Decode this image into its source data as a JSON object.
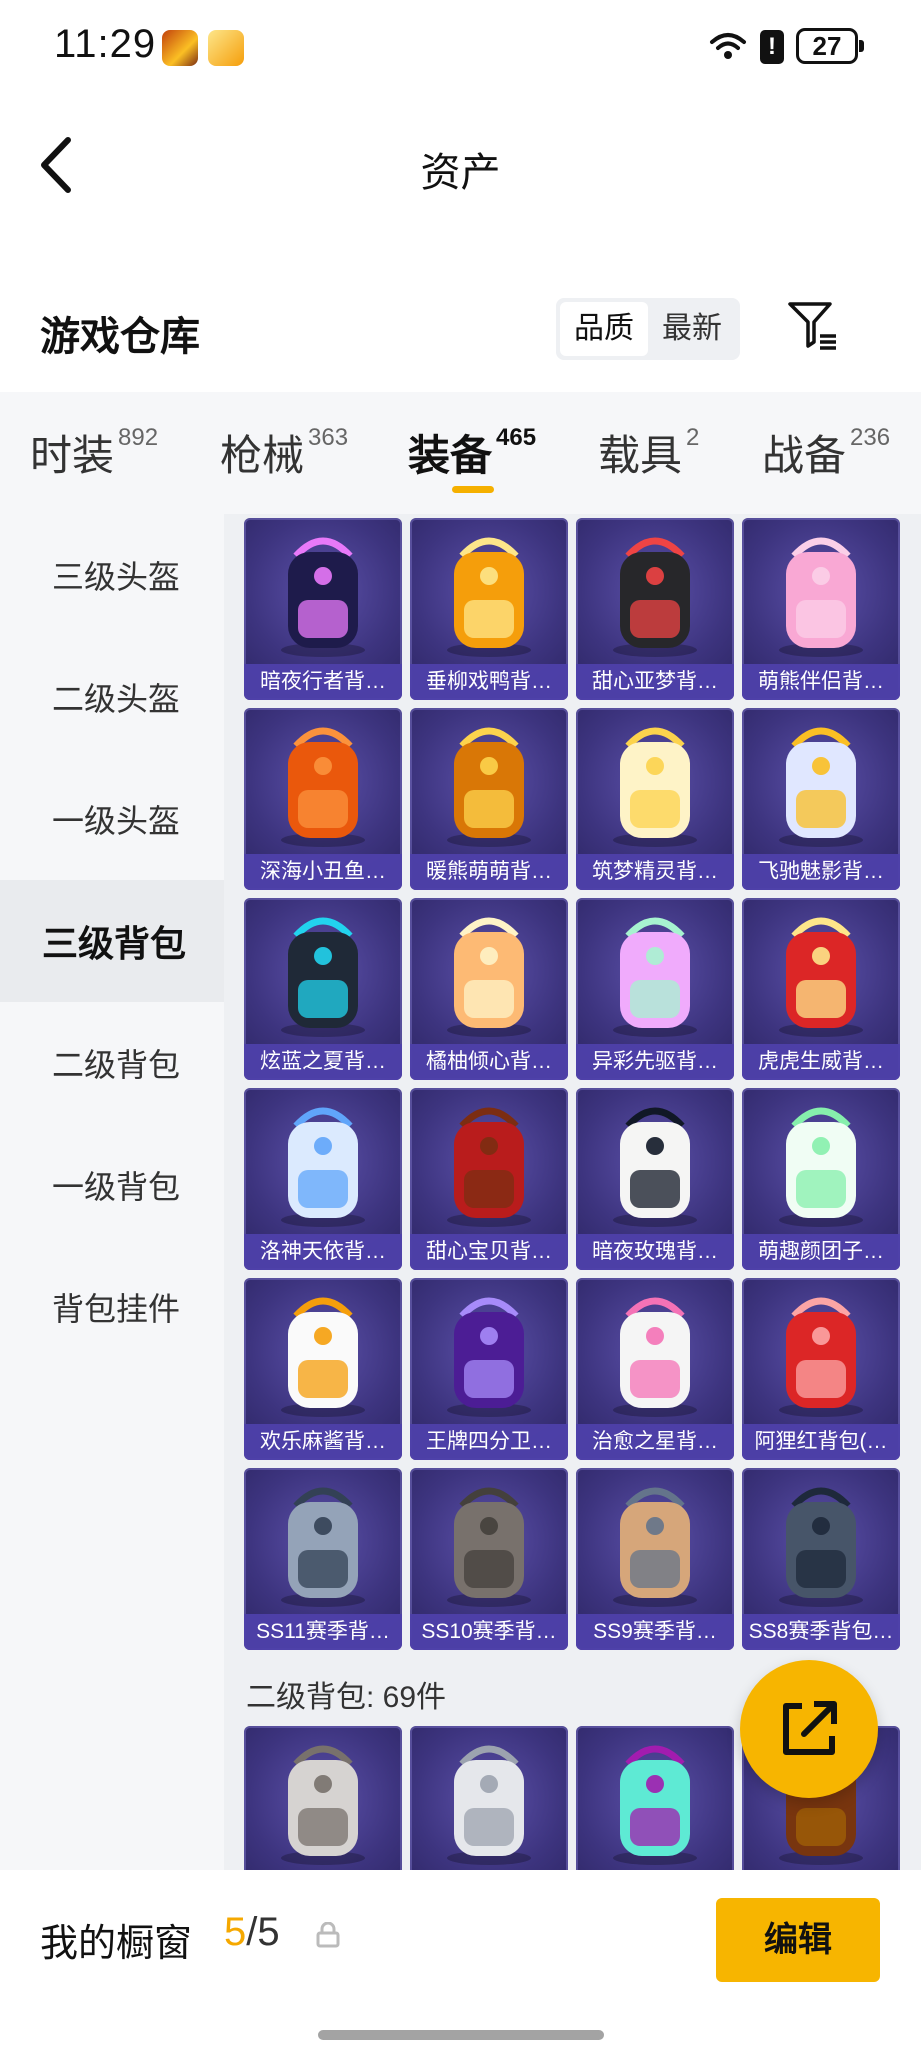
{
  "status_bar": {
    "time": "11:29",
    "battery": "27",
    "alert": "!"
  },
  "nav": {
    "title": "资产"
  },
  "warehouse": {
    "title": "游戏仓库",
    "sort": {
      "quality": "品质",
      "latest": "最新"
    }
  },
  "categories": [
    {
      "label": "时装",
      "count": "892"
    },
    {
      "label": "枪械",
      "count": "363"
    },
    {
      "label": "装备",
      "count": "465"
    },
    {
      "label": "载具",
      "count": "2"
    },
    {
      "label": "战备",
      "count": "236"
    }
  ],
  "sidebar": [
    {
      "label": "三级头盔"
    },
    {
      "label": "二级头盔"
    },
    {
      "label": "一级头盔"
    },
    {
      "label": "三级背包"
    },
    {
      "label": "二级背包"
    },
    {
      "label": "一级背包"
    },
    {
      "label": "背包挂件"
    }
  ],
  "items": [
    {
      "name": "暗夜行者背…",
      "color": "#1e1b4b",
      "accent": "#e879f9"
    },
    {
      "name": "垂柳戏鸭背…",
      "color": "#f59e0b",
      "accent": "#fde68a"
    },
    {
      "name": "甜心亚梦背…",
      "color": "#27272a",
      "accent": "#ef4444"
    },
    {
      "name": "萌熊伴侣背…",
      "color": "#f9a8d4",
      "accent": "#fbcfe8"
    },
    {
      "name": "深海小丑鱼…",
      "color": "#ea580c",
      "accent": "#fb923c"
    },
    {
      "name": "暖熊萌萌背…",
      "color": "#d97706",
      "accent": "#fcd34d"
    },
    {
      "name": "筑梦精灵背…",
      "color": "#fef3c7",
      "accent": "#fcd34d"
    },
    {
      "name": "飞驰魅影背…",
      "color": "#e0e7ff",
      "accent": "#fbbf24"
    },
    {
      "name": "炫蓝之夏背…",
      "color": "#1f2937",
      "accent": "#22d3ee"
    },
    {
      "name": "橘柚倾心背…",
      "color": "#fdba74",
      "accent": "#fef3c7"
    },
    {
      "name": "异彩先驱背…",
      "color": "#f0abfc",
      "accent": "#a7f3d0"
    },
    {
      "name": "虎虎生威背…",
      "color": "#dc2626",
      "accent": "#fde68a"
    },
    {
      "name": "洛神天依背…",
      "color": "#dbeafe",
      "accent": "#60a5fa"
    },
    {
      "name": "甜心宝贝背…",
      "color": "#b91c1c",
      "accent": "#7c2d12"
    },
    {
      "name": "暗夜玫瑰背…",
      "color": "#f5f5f4",
      "accent": "#111827"
    },
    {
      "name": "萌趣颜团子…",
      "color": "#f0fdf4",
      "accent": "#86efac"
    },
    {
      "name": "欢乐麻酱背…",
      "color": "#fafafa",
      "accent": "#f59e0b"
    },
    {
      "name": "王牌四分卫…",
      "color": "#4c1d95",
      "accent": "#a78bfa"
    },
    {
      "name": "治愈之星背…",
      "color": "#f5f5f5",
      "accent": "#f472b6"
    },
    {
      "name": "阿狸红背包(…",
      "color": "#dc2626",
      "accent": "#fca5a5"
    },
    {
      "name": "SS11赛季背…",
      "color": "#94a3b8",
      "accent": "#334155"
    },
    {
      "name": "SS10赛季背…",
      "color": "#78716c",
      "accent": "#44403c"
    },
    {
      "name": "SS9赛季背…",
      "color": "#d6a67a",
      "accent": "#64748b"
    },
    {
      "name": "SS8赛季背包…",
      "color": "#475569",
      "accent": "#1e293b"
    }
  ],
  "section2": {
    "header": "二级背包: 69件",
    "items": [
      {
        "color": "#d6d3d1",
        "accent": "#78716c"
      },
      {
        "color": "#e5e7eb",
        "accent": "#9ca3af"
      },
      {
        "color": "#5eead4",
        "accent": "#a21caf"
      },
      {
        "color": "#78350f",
        "accent": "#a16207"
      }
    ]
  },
  "bottom_bar": {
    "label": "我的橱窗",
    "current": "5",
    "slash": "/",
    "total": "5",
    "edit": "编辑"
  }
}
